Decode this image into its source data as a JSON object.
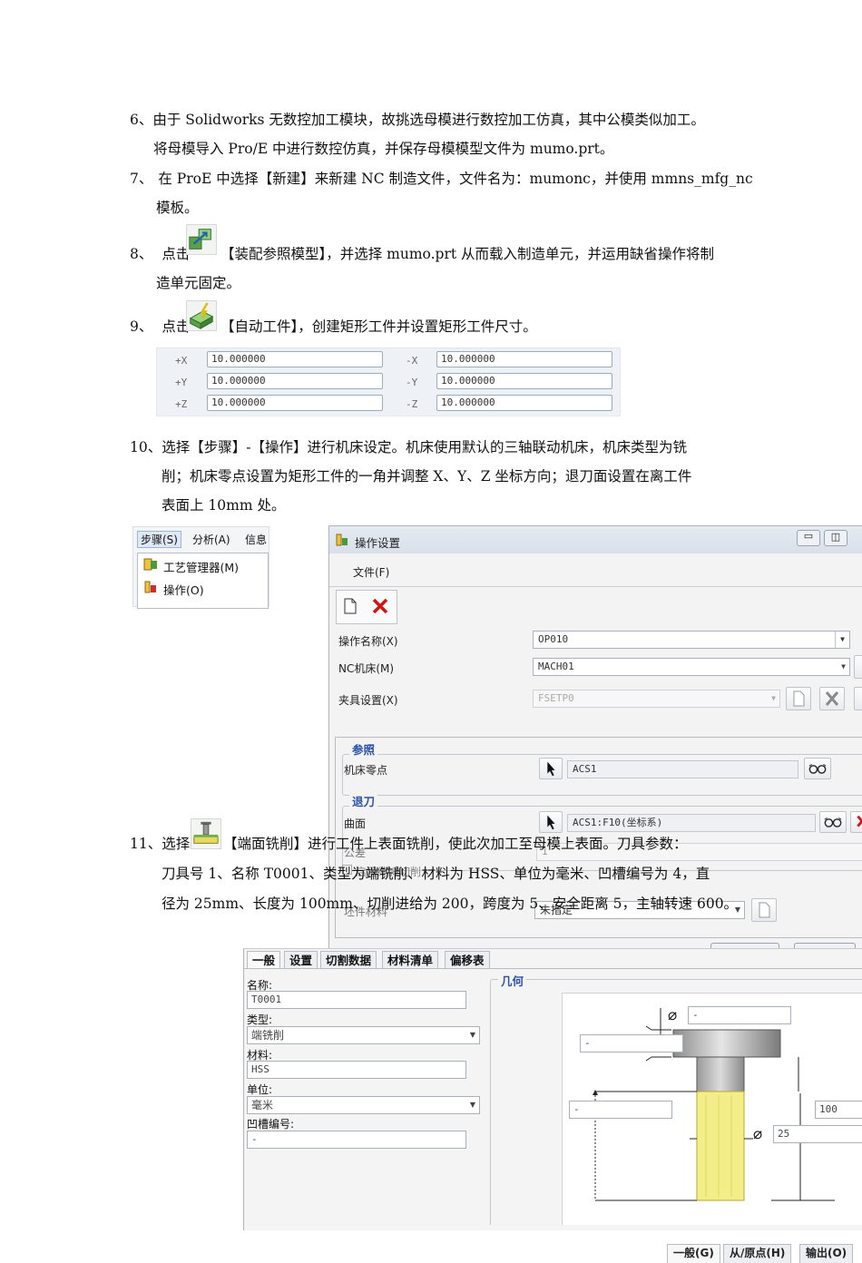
{
  "paragraphs": {
    "p6": {
      "num": "6、",
      "line1": "由于 Solidworks 无数控加工模块，故挑选母模进行数控加工仿真，其中公模类似加工。",
      "line2": "将母模导入 Pro/E 中进行数控仿真，并保存母模模型文件为 mumo.prt。"
    },
    "p7": {
      "num": "7、",
      "line1": "在 ProE 中选择【新建】来新建 NC 制造文件，文件名为：mumonc，并使用 mmns_mfg_nc",
      "line2": "模板。"
    },
    "p8": {
      "num": "8、",
      "pre": "点击",
      "line1": "【装配参照模型】，并选择 mumo.prt 从而载入制造单元，并运用缺省操作将制",
      "line2": "造单元固定。"
    },
    "p9": {
      "num": "9、",
      "pre": "点击",
      "line1": "【自动工件】，创建矩形工件并设置矩形工件尺寸。"
    },
    "p10": {
      "num": "10、",
      "line1": "选择【步骤】-【操作】进行机床设定。机床使用默认的三轴联动机床，机床类型为铣",
      "line2": "削；机床零点设置为矩形工件的一角并调整 X、Y、Z 坐标方向；退刀面设置在离工件",
      "line3": "表面上 10mm 处。"
    },
    "p11": {
      "num": "11、",
      "pre": "选择",
      "line1": "【端面铣削】进行工件上表面铣削，使此次加工至母模上表面。刀具参数：",
      "line2": "刀具号 1、名称 T0001、类型为端铣削、材料为 HSS、单位为毫米、凹槽编号为 4，直",
      "line3": "径为 25mm、长度为 100mm、切削进给为 200，跨度为 5、安全距离 5，主轴转速 600。"
    }
  },
  "dims": {
    "px_label": "+X",
    "px": "10.000000",
    "py_label": "+Y",
    "py": "10.000000",
    "pz_label": "+Z",
    "pz": "10.000000",
    "nx_label": "-X",
    "nx": "10.000000",
    "ny_label": "-Y",
    "ny": "10.000000",
    "nz_label": "-Z",
    "nz": "10.000000"
  },
  "menu": {
    "bar": [
      "步骤(S)",
      "分析(A)",
      "信息"
    ],
    "items": [
      "工艺管理器(M)",
      "操作(O)"
    ]
  },
  "op_dialog": {
    "title": "操作设置",
    "file_menu": "文件(F)",
    "op_name_label": "操作名称(X)",
    "op_name": "OP010",
    "nc_machine_label": "NC机床(M)",
    "nc_machine": "MACH01",
    "fixture_label": "夹具设置(X)",
    "fixture": "FSETP0",
    "tabs": [
      "一般(G)",
      "从/原点(H)",
      "输出(O)"
    ],
    "ref_group": "参照",
    "machine_zero_label": "机床零点",
    "machine_zero": "ACS1",
    "retract_group": "退刀",
    "surface_label": "曲面",
    "surface": "ACS1:F10(坐标系)",
    "tolerance_label": "公差",
    "tolerance": "1",
    "stock_option": "启用缩减切削",
    "stock_material_label": "坯件材料",
    "stock_material": "未指定"
  },
  "tool_dialog": {
    "tabs": [
      "一般",
      "设置",
      "切割数据",
      "材料清单",
      "偏移表"
    ],
    "name_label": "名称:",
    "name": "T0001",
    "type_label": "类型:",
    "type": "端铣削",
    "material_label": "材料:",
    "material": "HSS",
    "unit_label": "单位:",
    "unit": "毫米",
    "groove_label": "凹槽编号:",
    "groove": "-",
    "geometry_group": "几何",
    "dia_top": "-",
    "flange": "-",
    "shank": "-",
    "length": "100",
    "diameter": "25"
  },
  "colors": {
    "accent_blue": "#2b52a8",
    "close_red": "#d01414",
    "tool_yellow": "#f3ee8a"
  }
}
